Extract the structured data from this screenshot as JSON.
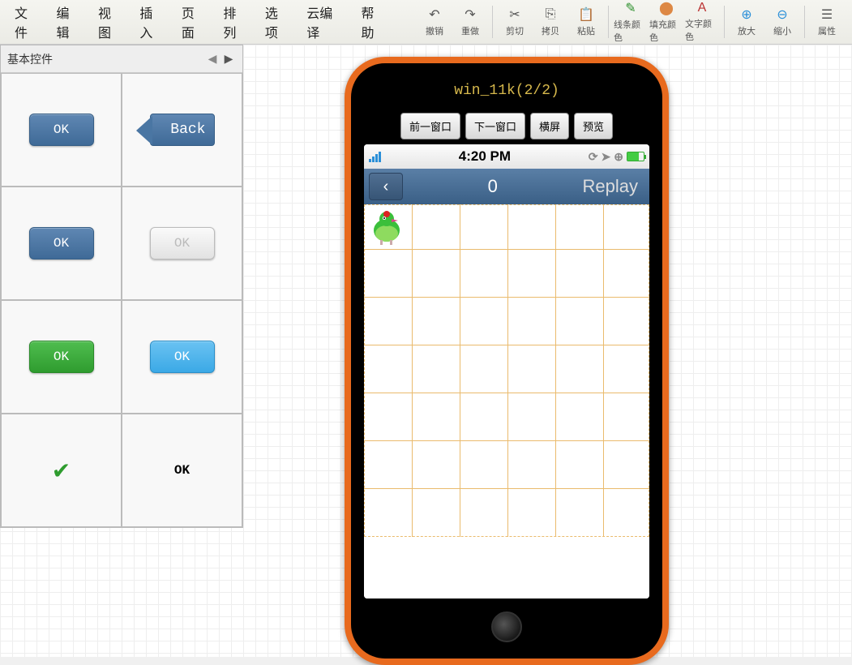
{
  "menu": [
    "文件",
    "编辑",
    "视图",
    "插入",
    "页面",
    "排列",
    "选项",
    "云编译",
    "帮助"
  ],
  "toolbar": [
    {
      "label": "撤销",
      "ico": "↶"
    },
    {
      "label": "重做",
      "ico": "↷"
    },
    {
      "sep": true
    },
    {
      "label": "剪切",
      "ico": "✂"
    },
    {
      "label": "拷贝",
      "ico": "⎘"
    },
    {
      "label": "粘贴",
      "ico": "📋"
    },
    {
      "sep": true
    },
    {
      "label": "线条颜色",
      "ico": "✎",
      "color": "#2a8f2a"
    },
    {
      "label": "填充颜色",
      "ico": "⬤",
      "color": "#d84"
    },
    {
      "label": "文字颜色",
      "ico": "A",
      "color": "#b33"
    },
    {
      "sep": true
    },
    {
      "label": "放大",
      "ico": "⊕",
      "color": "#2a8fd8"
    },
    {
      "label": "缩小",
      "ico": "⊖",
      "color": "#2a8fd8"
    },
    {
      "sep": true
    },
    {
      "label": "属性",
      "ico": "☰"
    }
  ],
  "palette": {
    "title": "基本控件",
    "cells": [
      {
        "type": "btn-blue",
        "text": "OK"
      },
      {
        "type": "btn-back",
        "text": "Back"
      },
      {
        "type": "btn-blue",
        "text": "OK"
      },
      {
        "type": "btn-grey",
        "text": "OK"
      },
      {
        "type": "btn-green",
        "text": "OK"
      },
      {
        "type": "btn-lightblue",
        "text": "OK"
      },
      {
        "type": "check",
        "text": ""
      },
      {
        "type": "plain",
        "text": "OK"
      }
    ]
  },
  "phone": {
    "title": "win_11k(2/2)",
    "ctrls": [
      "前一窗口",
      "下一窗口",
      "横屏",
      "预览"
    ],
    "time": "4:20 PM",
    "score": "0",
    "replay": "Replay"
  }
}
